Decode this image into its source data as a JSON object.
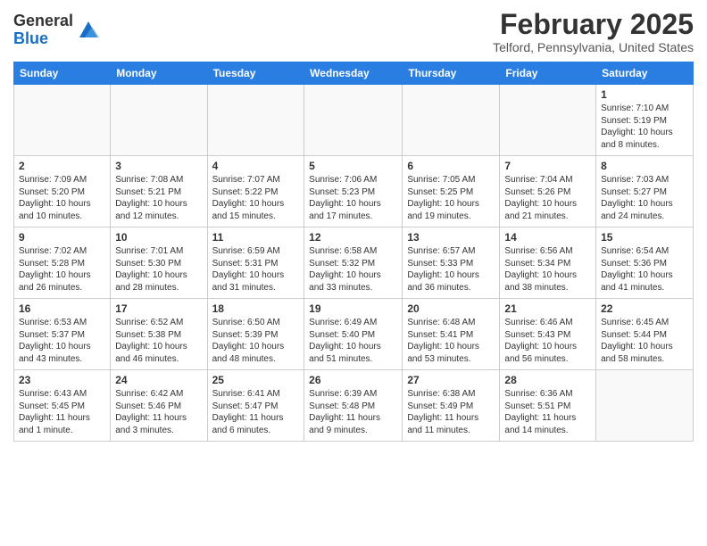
{
  "logo": {
    "general": "General",
    "blue": "Blue"
  },
  "header": {
    "title": "February 2025",
    "subtitle": "Telford, Pennsylvania, United States"
  },
  "weekdays": [
    "Sunday",
    "Monday",
    "Tuesday",
    "Wednesday",
    "Thursday",
    "Friday",
    "Saturday"
  ],
  "weeks": [
    [
      {
        "day": "",
        "info": ""
      },
      {
        "day": "",
        "info": ""
      },
      {
        "day": "",
        "info": ""
      },
      {
        "day": "",
        "info": ""
      },
      {
        "day": "",
        "info": ""
      },
      {
        "day": "",
        "info": ""
      },
      {
        "day": "1",
        "info": "Sunrise: 7:10 AM\nSunset: 5:19 PM\nDaylight: 10 hours\nand 8 minutes."
      }
    ],
    [
      {
        "day": "2",
        "info": "Sunrise: 7:09 AM\nSunset: 5:20 PM\nDaylight: 10 hours\nand 10 minutes."
      },
      {
        "day": "3",
        "info": "Sunrise: 7:08 AM\nSunset: 5:21 PM\nDaylight: 10 hours\nand 12 minutes."
      },
      {
        "day": "4",
        "info": "Sunrise: 7:07 AM\nSunset: 5:22 PM\nDaylight: 10 hours\nand 15 minutes."
      },
      {
        "day": "5",
        "info": "Sunrise: 7:06 AM\nSunset: 5:23 PM\nDaylight: 10 hours\nand 17 minutes."
      },
      {
        "day": "6",
        "info": "Sunrise: 7:05 AM\nSunset: 5:25 PM\nDaylight: 10 hours\nand 19 minutes."
      },
      {
        "day": "7",
        "info": "Sunrise: 7:04 AM\nSunset: 5:26 PM\nDaylight: 10 hours\nand 21 minutes."
      },
      {
        "day": "8",
        "info": "Sunrise: 7:03 AM\nSunset: 5:27 PM\nDaylight: 10 hours\nand 24 minutes."
      }
    ],
    [
      {
        "day": "9",
        "info": "Sunrise: 7:02 AM\nSunset: 5:28 PM\nDaylight: 10 hours\nand 26 minutes."
      },
      {
        "day": "10",
        "info": "Sunrise: 7:01 AM\nSunset: 5:30 PM\nDaylight: 10 hours\nand 28 minutes."
      },
      {
        "day": "11",
        "info": "Sunrise: 6:59 AM\nSunset: 5:31 PM\nDaylight: 10 hours\nand 31 minutes."
      },
      {
        "day": "12",
        "info": "Sunrise: 6:58 AM\nSunset: 5:32 PM\nDaylight: 10 hours\nand 33 minutes."
      },
      {
        "day": "13",
        "info": "Sunrise: 6:57 AM\nSunset: 5:33 PM\nDaylight: 10 hours\nand 36 minutes."
      },
      {
        "day": "14",
        "info": "Sunrise: 6:56 AM\nSunset: 5:34 PM\nDaylight: 10 hours\nand 38 minutes."
      },
      {
        "day": "15",
        "info": "Sunrise: 6:54 AM\nSunset: 5:36 PM\nDaylight: 10 hours\nand 41 minutes."
      }
    ],
    [
      {
        "day": "16",
        "info": "Sunrise: 6:53 AM\nSunset: 5:37 PM\nDaylight: 10 hours\nand 43 minutes."
      },
      {
        "day": "17",
        "info": "Sunrise: 6:52 AM\nSunset: 5:38 PM\nDaylight: 10 hours\nand 46 minutes."
      },
      {
        "day": "18",
        "info": "Sunrise: 6:50 AM\nSunset: 5:39 PM\nDaylight: 10 hours\nand 48 minutes."
      },
      {
        "day": "19",
        "info": "Sunrise: 6:49 AM\nSunset: 5:40 PM\nDaylight: 10 hours\nand 51 minutes."
      },
      {
        "day": "20",
        "info": "Sunrise: 6:48 AM\nSunset: 5:41 PM\nDaylight: 10 hours\nand 53 minutes."
      },
      {
        "day": "21",
        "info": "Sunrise: 6:46 AM\nSunset: 5:43 PM\nDaylight: 10 hours\nand 56 minutes."
      },
      {
        "day": "22",
        "info": "Sunrise: 6:45 AM\nSunset: 5:44 PM\nDaylight: 10 hours\nand 58 minutes."
      }
    ],
    [
      {
        "day": "23",
        "info": "Sunrise: 6:43 AM\nSunset: 5:45 PM\nDaylight: 11 hours\nand 1 minute."
      },
      {
        "day": "24",
        "info": "Sunrise: 6:42 AM\nSunset: 5:46 PM\nDaylight: 11 hours\nand 3 minutes."
      },
      {
        "day": "25",
        "info": "Sunrise: 6:41 AM\nSunset: 5:47 PM\nDaylight: 11 hours\nand 6 minutes."
      },
      {
        "day": "26",
        "info": "Sunrise: 6:39 AM\nSunset: 5:48 PM\nDaylight: 11 hours\nand 9 minutes."
      },
      {
        "day": "27",
        "info": "Sunrise: 6:38 AM\nSunset: 5:49 PM\nDaylight: 11 hours\nand 11 minutes."
      },
      {
        "day": "28",
        "info": "Sunrise: 6:36 AM\nSunset: 5:51 PM\nDaylight: 11 hours\nand 14 minutes."
      },
      {
        "day": "",
        "info": ""
      }
    ]
  ]
}
